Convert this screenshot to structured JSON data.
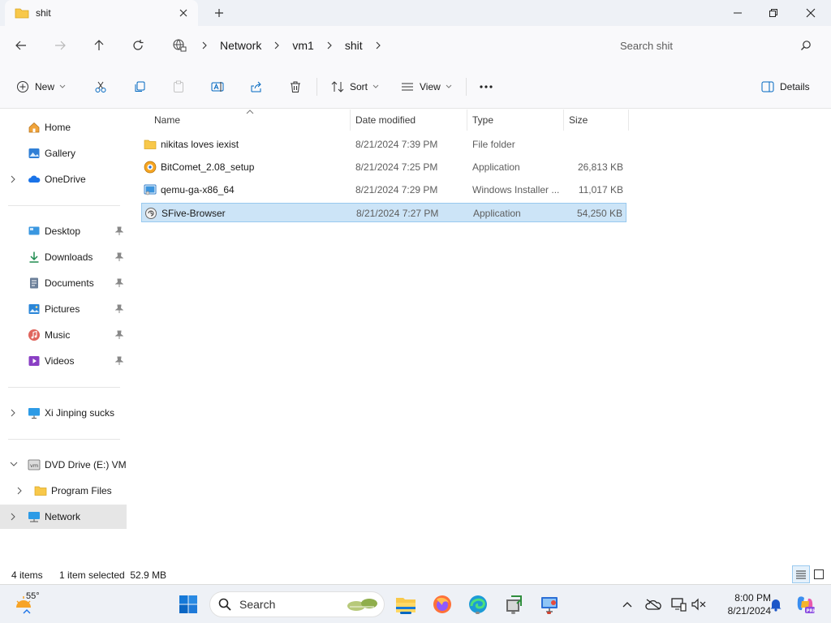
{
  "window": {
    "tab_title": "shit"
  },
  "address": {
    "crumbs": [
      "Network",
      "vm1",
      "shit"
    ],
    "search_placeholder": "Search shit"
  },
  "commands": {
    "new": "New",
    "sort": "Sort",
    "view": "View",
    "details": "Details"
  },
  "sidebar": {
    "quick": [
      {
        "label": "Home",
        "icon": "home-icon"
      },
      {
        "label": "Gallery",
        "icon": "gallery-icon"
      },
      {
        "label": "OneDrive",
        "icon": "onedrive-icon"
      }
    ],
    "pinned": [
      {
        "label": "Desktop",
        "icon": "desktop-icon"
      },
      {
        "label": "Downloads",
        "icon": "downloads-icon"
      },
      {
        "label": "Documents",
        "icon": "documents-icon"
      },
      {
        "label": "Pictures",
        "icon": "pictures-icon"
      },
      {
        "label": "Music",
        "icon": "music-icon"
      },
      {
        "label": "Videos",
        "icon": "videos-icon"
      }
    ],
    "computer": "Xi Jinping sucks",
    "dvd": "DVD Drive (E:) VMware Tools",
    "program_files": "Program Files",
    "network": "Network"
  },
  "columns": {
    "name": "Name",
    "date": "Date modified",
    "type": "Type",
    "size": "Size"
  },
  "files": [
    {
      "name": "nikitas loves iexist",
      "date": "8/21/2024 7:39 PM",
      "type": "File folder",
      "size": "",
      "icon": "folder-icon"
    },
    {
      "name": "BitComet_2.08_setup",
      "date": "8/21/2024 7:25 PM",
      "type": "Application",
      "size": "26,813 KB",
      "icon": "bitcomet-icon"
    },
    {
      "name": "qemu-ga-x86_64",
      "date": "8/21/2024 7:29 PM",
      "type": "Windows Installer ...",
      "size": "11,017 KB",
      "icon": "installer-icon"
    },
    {
      "name": "SFive-Browser",
      "date": "8/21/2024 7:27 PM",
      "type": "Application",
      "size": "54,250 KB",
      "icon": "app-icon"
    }
  ],
  "status": {
    "items": "4 items",
    "selected": "1 item selected  52.9 MB"
  },
  "taskbar": {
    "temperature": "55°",
    "search_placeholder": "Search",
    "time": "8:00 PM",
    "date": "8/21/2024"
  },
  "colors": {
    "accent": "#0067c0",
    "selection": "#cce4f7",
    "folder": "#f8c84a"
  }
}
